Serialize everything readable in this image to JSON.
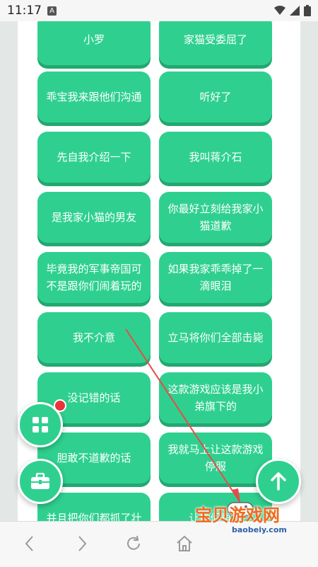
{
  "status_bar": {
    "time": "11:17",
    "notification_badge": "A"
  },
  "buttons": [
    "小罗",
    "家猫受委屈了",
    "乖宝我来跟他们沟通",
    "听好了",
    "先自我介绍一下",
    "我叫蒋介石",
    "是我家小猫的男友",
    "你最好立刻给我家小猫道歉",
    "毕竟我的军事帝国可不是跟你们闹着玩的",
    "如果我家乖乖掉了一滴眼泪",
    "我不介意",
    "立马将你们全部击毙",
    "没记错的话",
    "这款游戏应该是我小弟旗下的",
    "胆敢不道歉的话",
    "我就马上让这款游戏停服",
    "并且把你们都抓了壮",
    "让你们再也"
  ],
  "watermark": {
    "title": "宝贝游戏网",
    "url": "baobeiy.com"
  },
  "colors": {
    "accent": "#2fd08f",
    "accent_shadow": "#23a872",
    "badge": "#e8343b"
  },
  "icons": {
    "fab_grid": "grid-icon",
    "fab_toolbox": "toolbox-icon",
    "fab_up": "arrow-up-icon",
    "nav": [
      "back-icon",
      "forward-icon",
      "refresh-icon",
      "home-icon"
    ]
  }
}
